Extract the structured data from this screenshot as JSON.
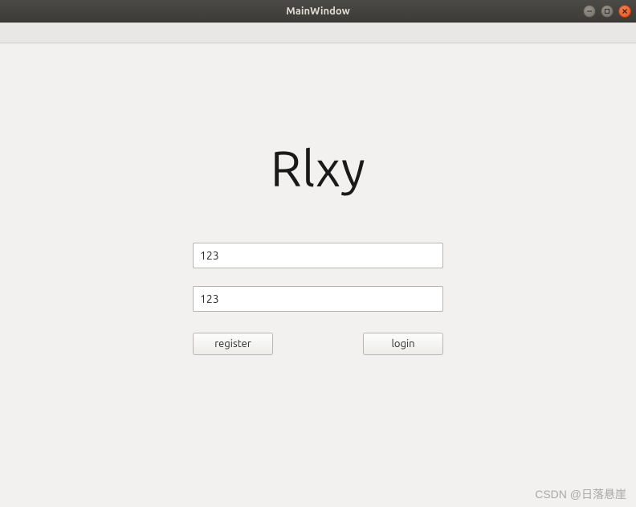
{
  "window": {
    "title": "MainWindow"
  },
  "app": {
    "logo": "Rlxy"
  },
  "form": {
    "field1_value": "123",
    "field2_value": "123"
  },
  "buttons": {
    "register": "register",
    "login": "login"
  },
  "watermark": "CSDN @日落悬崖"
}
